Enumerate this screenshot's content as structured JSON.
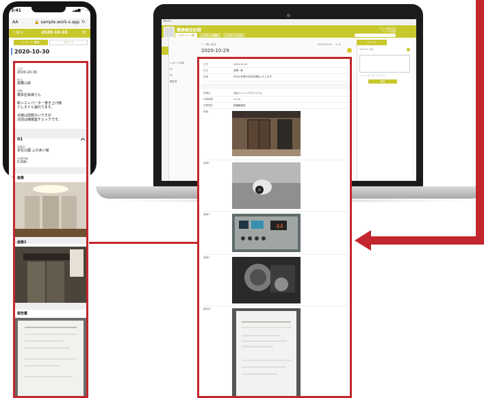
{
  "laptop_app": {
    "top_bar": "Works",
    "title": "業務報告記録",
    "tabs": [
      "レポート一覧",
      "レポート編集",
      "レポート作成"
    ],
    "user": [
      "テスト株式会社",
      "テスト担当者"
    ],
    "back_link": "← 一覧へ戻る",
    "report_date": "2020-10-29",
    "nav_text": "2020-10-29 ・ 1 / 5",
    "tree": [
      "レポート作成",
      "01",
      "02",
      "報告書"
    ],
    "comment_tab": "コメント",
    "comment_label": "コメント (0)",
    "comment_hint": "コメントを入力してください",
    "comment_send": "送信"
  },
  "report": {
    "rows": [
      {
        "key": "日付",
        "value": "2020-10-29"
      },
      {
        "key": "担当",
        "value": "営業一郎"
      },
      {
        "key": "詳細",
        "value": "本日の作業の内容を報告いたします。"
      },
      {
        "key": "現場名",
        "value": "井谷パンニングスクエアム"
      },
      {
        "key": "作業時間",
        "value": "3.5 hr"
      },
      {
        "key": "作業場所",
        "value": "設備機械室"
      },
      {
        "key": "画像",
        "value": ""
      },
      {
        "key": "画像2",
        "value": ""
      },
      {
        "key": "画像3",
        "value": ""
      },
      {
        "key": "画像4",
        "value": ""
      },
      {
        "key": "報告書",
        "value": ""
      }
    ]
  },
  "phone": {
    "time": "3:41",
    "status": "▂▄▆ ◠ ▭",
    "aa": "AA",
    "url": "🔒 sample.work-s.app",
    "reload": "↻",
    "back": "〈 戻る",
    "bar_title": "2020-10-30",
    "menu": "≡",
    "tab_active": "レコード 編集",
    "tab_inactive": "コメント",
    "date": "2020-10-30",
    "detail": {
      "date_label": "日付",
      "date_value": "2020-10-30",
      "staff_label": "担当",
      "staff_value": "高橋三郎",
      "memo_label": "詳細",
      "memo_lines": [
        "橋本店長様さん",
        "",
        "新ハエレベーター巻き上げ機",
        "少しオイル漏れてます。",
        "",
        "点検は問題ないですが",
        "次回は機械室チェックです。"
      ],
      "section_title": "01",
      "site_label": "現場名",
      "site_value": "本社公園 ふれあい館",
      "time_label": "作業時間",
      "time_value": "0.00h",
      "img1_label": "画像",
      "img2_label": "画像2",
      "report_label": "報告書"
    }
  }
}
